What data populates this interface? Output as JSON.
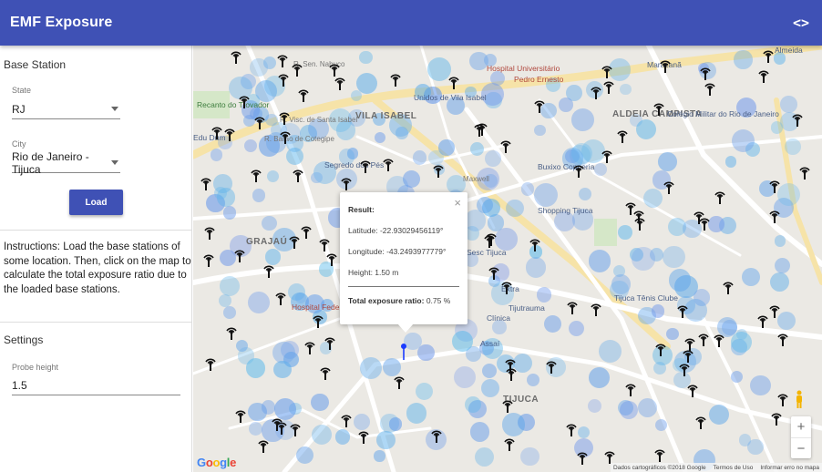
{
  "app": {
    "title": "EMF Exposure",
    "toggle_label": "<>"
  },
  "sidebar": {
    "base_station_title": "Base Station",
    "state": {
      "label": "State",
      "value": "RJ"
    },
    "city": {
      "label": "City",
      "value": "Rio de Janeiro - Tijuca"
    },
    "load_label": "Load",
    "instructions": "Instructions: Load the base stations of some location. Then, click on the map to calculate the total exposure ratio due to the loaded base stations.",
    "settings_title": "Settings",
    "probe": {
      "label": "Probe height",
      "value": "1.5"
    }
  },
  "map": {
    "labels": {
      "sen_nabuco": "R. Sen. Nabuco",
      "frei_caneca": "Recanto do Trovador",
      "hospital_univ": "Hospital Universitário",
      "pedro_ernesto": "Pedro Ernesto",
      "maracana": "Maracanã",
      "vila_isabel": "VILA ISABEL",
      "unidos": "Unidos de Vila Isabel",
      "visc_santa_isabel": "R. Visc. de Santa Isabel",
      "barao_cotegipe": "R. Barão de Cotegipe",
      "aldeia_campista": "ALDEIA CAMPISTA",
      "colegio_militar": "Colégio Militar do Rio de Janeiro",
      "edu_dum": "Edu Dum",
      "segredo_pes": "Segredo dos Pés",
      "buxixo": "Buxixo Copperia",
      "shopping": "Shopping Tijuca",
      "grajau": "GRAJAÚ",
      "sesc": "Sesc Tijuca",
      "hospital_fed": "Hospital Federal",
      "tijuca_tenis": "Tijuca Tênis Clube",
      "extra": "Extra",
      "clinica": "Clínica",
      "tijutrauma": "Tijutrauma",
      "assai": "Assaí",
      "tijuca": "TIJUCA",
      "almeida": "Almeida",
      "maxwell": "Maxwell",
      "recreio": "Recanto"
    },
    "popup": {
      "title": "Result:",
      "latitude": "Latitude: -22.93029456119°",
      "longitude": "Longitude: -43.2493977779°",
      "height": "Height: 1.50 m",
      "total_label": "Total exposure ratio:",
      "total_value": "0.75 %"
    },
    "zoom_in": "+",
    "zoom_out": "−",
    "google_logo": "Google",
    "attribution": {
      "data": "Dados cartográficos ©2018 Google",
      "terms": "Termos de Uso",
      "report": "Informar erro no mapa"
    }
  }
}
